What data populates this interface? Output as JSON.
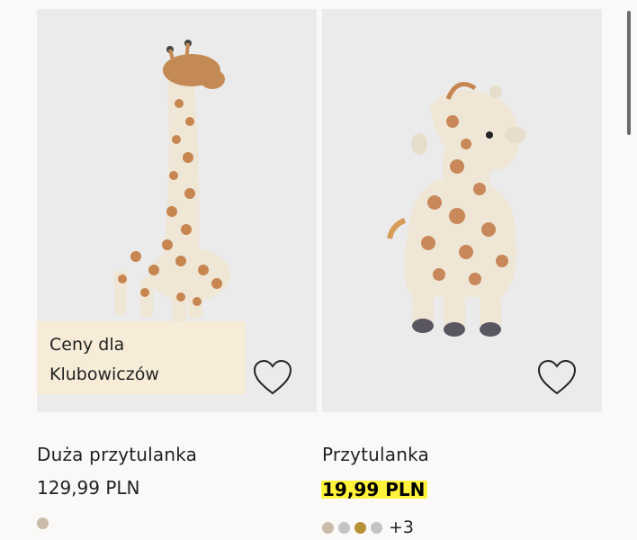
{
  "products": [
    {
      "name": "Duża przytulanka",
      "price": "129,99 PLN",
      "badge": "Ceny dla Klubowiczów",
      "badge_line1": "Ceny dla",
      "badge_line2": "Klubowiczów",
      "swatches": [
        "#c9bca8"
      ],
      "more_colors": ""
    },
    {
      "name": "Przytulanka",
      "price": "19,99 PLN",
      "sale_highlight": "#fff23a",
      "swatches": [
        "#c9bca8",
        "#c4c4c4",
        "#b89137",
        "#c4c4c4"
      ],
      "more_colors": "+3"
    }
  ]
}
